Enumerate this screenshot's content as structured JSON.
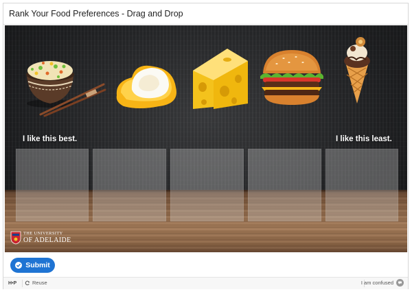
{
  "title": "Rank Your Food Preferences - Drag and Drop",
  "labels": {
    "best": "I like this best.",
    "least": "I like this least."
  },
  "foods": [
    "fried rice bowl with chopsticks",
    "poached egg",
    "cheese wedge",
    "cheeseburger",
    "ice cream cone"
  ],
  "branding": {
    "university_small": "THE UNIVERSITY",
    "university_big": "OF ADELAIDE"
  },
  "submit_label": "Submit",
  "footer": {
    "h5p": "H•P",
    "reuse": "Reuse",
    "confused": "I am confused"
  },
  "colors": {
    "accent": "#1f74d3",
    "background": "#1d1e20",
    "table": "#8a6446"
  }
}
